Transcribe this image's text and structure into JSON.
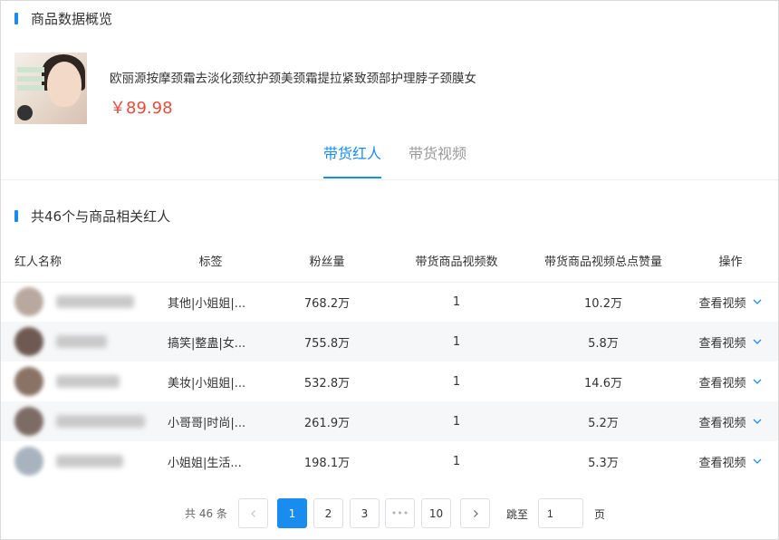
{
  "overview": {
    "title": "商品数据概览"
  },
  "product": {
    "name": "欧丽源按摩颈霜去淡化颈纹护颈美颈霜提拉紧致颈部护理脖子颈膜女",
    "price": "￥89.98"
  },
  "tabs": [
    {
      "label": "带货红人",
      "active": true
    },
    {
      "label": "带货视频",
      "active": false
    }
  ],
  "related": {
    "title": "共46个与商品相关红人"
  },
  "table": {
    "headers": [
      "红人名称",
      "标签",
      "粉丝量",
      "带货商品视频数",
      "带货商品视频总点赞量",
      "操作"
    ],
    "rows": [
      {
        "tags": "其他|小姐姐|...",
        "fans": "768.2万",
        "video_count": "1",
        "likes": "10.2万",
        "action": "查看视频",
        "avatar_color": "#b9a8a0",
        "name_width": 86
      },
      {
        "tags": "搞笑|整蛊|女...",
        "fans": "755.8万",
        "video_count": "1",
        "likes": "5.8万",
        "action": "查看视频",
        "avatar_color": "#6e5a52",
        "name_width": 56
      },
      {
        "tags": "美妆|小姐姐|...",
        "fans": "532.8万",
        "video_count": "1",
        "likes": "14.6万",
        "action": "查看视频",
        "avatar_color": "#8a7266",
        "name_width": 70
      },
      {
        "tags": "小哥哥|时尚|...",
        "fans": "261.9万",
        "video_count": "1",
        "likes": "5.2万",
        "action": "查看视频",
        "avatar_color": "#7d6b66",
        "name_width": 98
      },
      {
        "tags": "小姐姐|生活...",
        "fans": "198.1万",
        "video_count": "1",
        "likes": "5.3万",
        "action": "查看视频",
        "avatar_color": "#a9b3bf",
        "name_width": 74
      }
    ]
  },
  "pagination": {
    "total": "共 46 条",
    "pages": [
      "1",
      "2",
      "3",
      "•••",
      "10"
    ],
    "current": "1",
    "jump_label": "跳至",
    "jump_value": "1",
    "suffix": "页"
  },
  "colors": {
    "accent": "#1a8cf0",
    "price": "#e84b3c",
    "row_alt": "#f6f7f9"
  }
}
